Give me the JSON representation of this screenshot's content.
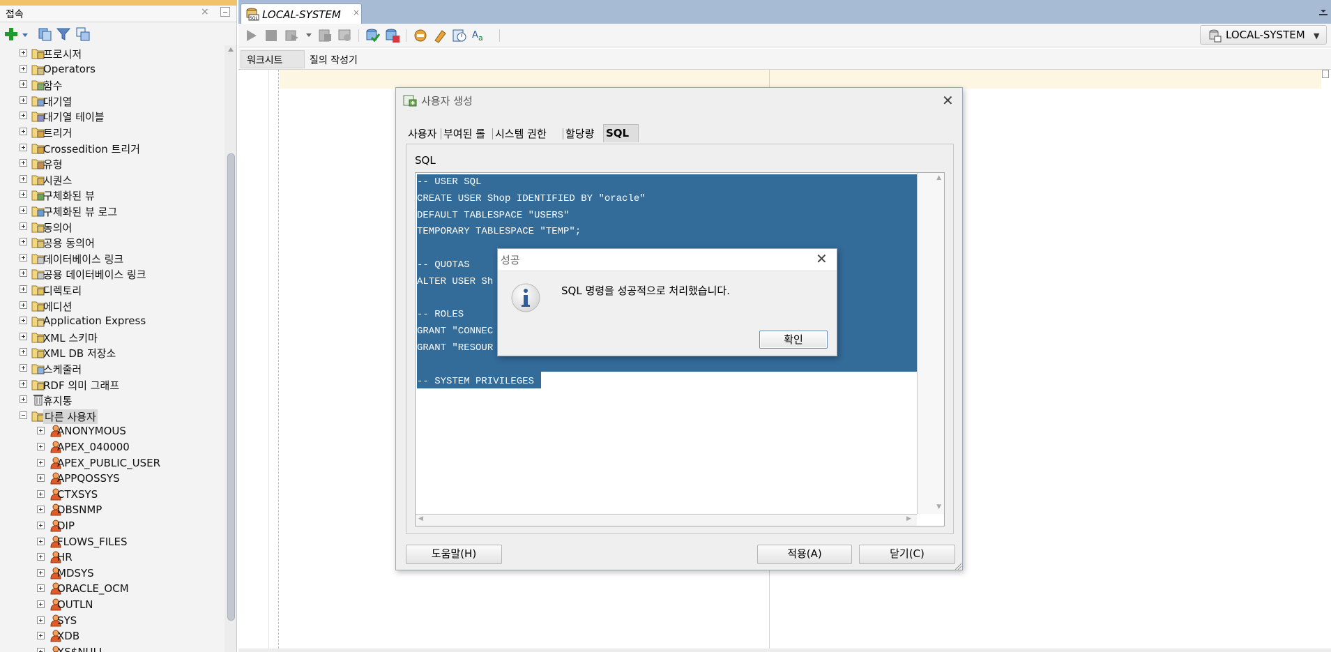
{
  "left_panel": {
    "title": "접속",
    "toolbar_icons": [
      "add-connection-icon",
      "dropdown-arrow-icon",
      "refresh-icon",
      "filter-icon",
      "schema-browser-icon"
    ],
    "tree": [
      {
        "label": "프로시저",
        "level": 1,
        "icon": "procedure-icon",
        "expanded": false
      },
      {
        "label": "Operators",
        "level": 1,
        "icon": "operator-icon",
        "expanded": false
      },
      {
        "label": "함수",
        "level": 1,
        "icon": "function-icon",
        "expanded": false
      },
      {
        "label": "대기열",
        "level": 1,
        "icon": "queue-icon",
        "expanded": false
      },
      {
        "label": "대기열 테이블",
        "level": 1,
        "icon": "queue-table-icon",
        "expanded": false
      },
      {
        "label": "트리거",
        "level": 1,
        "icon": "trigger-icon",
        "expanded": false
      },
      {
        "label": "Crossedition 트리거",
        "level": 1,
        "icon": "crossedition-trigger-icon",
        "expanded": false
      },
      {
        "label": "유형",
        "level": 1,
        "icon": "type-icon",
        "expanded": false
      },
      {
        "label": "시퀀스",
        "level": 1,
        "icon": "sequence-icon",
        "expanded": false
      },
      {
        "label": "구체화된 뷰",
        "level": 1,
        "icon": "materialized-view-icon",
        "expanded": false
      },
      {
        "label": "구체화된 뷰 로그",
        "level": 1,
        "icon": "materialized-view-log-icon",
        "expanded": false
      },
      {
        "label": "동의어",
        "level": 1,
        "icon": "synonym-icon",
        "expanded": false
      },
      {
        "label": "공용 동의어",
        "level": 1,
        "icon": "public-synonym-icon",
        "expanded": false
      },
      {
        "label": "데이터베이스 링크",
        "level": 1,
        "icon": "database-link-icon",
        "expanded": false
      },
      {
        "label": "공용 데이터베이스 링크",
        "level": 1,
        "icon": "public-database-link-icon",
        "expanded": false
      },
      {
        "label": "디렉토리",
        "level": 1,
        "icon": "directory-icon",
        "expanded": false
      },
      {
        "label": "에디션",
        "level": 1,
        "icon": "edition-icon",
        "expanded": false
      },
      {
        "label": "Application Express",
        "level": 1,
        "icon": "folder-icon",
        "expanded": false
      },
      {
        "label": "XML 스키마",
        "level": 1,
        "icon": "xml-schema-icon",
        "expanded": false
      },
      {
        "label": "XML DB 저장소",
        "level": 1,
        "icon": "xml-db-repository-icon",
        "expanded": false
      },
      {
        "label": "스케줄러",
        "level": 1,
        "icon": "scheduler-icon",
        "expanded": false
      },
      {
        "label": "RDF 의미 그래프",
        "level": 1,
        "icon": "rdf-graph-icon",
        "expanded": false
      },
      {
        "label": "휴지통",
        "level": 1,
        "icon": "recycle-bin-icon",
        "expanded": false
      },
      {
        "label": "다른 사용자",
        "level": 1,
        "icon": "other-users-icon",
        "expanded": true,
        "selected": true
      },
      {
        "label": "ANONYMOUS",
        "level": 2,
        "icon": "user-icon",
        "expanded": false
      },
      {
        "label": "APEX_040000",
        "level": 2,
        "icon": "user-icon",
        "expanded": false
      },
      {
        "label": "APEX_PUBLIC_USER",
        "level": 2,
        "icon": "user-icon",
        "expanded": false
      },
      {
        "label": "APPQOSSYS",
        "level": 2,
        "icon": "user-icon",
        "expanded": false
      },
      {
        "label": "CTXSYS",
        "level": 2,
        "icon": "user-icon",
        "expanded": false
      },
      {
        "label": "DBSNMP",
        "level": 2,
        "icon": "user-icon",
        "expanded": false
      },
      {
        "label": "DIP",
        "level": 2,
        "icon": "user-icon",
        "expanded": false
      },
      {
        "label": "FLOWS_FILES",
        "level": 2,
        "icon": "user-icon",
        "expanded": false
      },
      {
        "label": "HR",
        "level": 2,
        "icon": "user-icon",
        "expanded": false
      },
      {
        "label": "MDSYS",
        "level": 2,
        "icon": "user-icon",
        "expanded": false
      },
      {
        "label": "ORACLE_OCM",
        "level": 2,
        "icon": "user-icon",
        "expanded": false
      },
      {
        "label": "OUTLN",
        "level": 2,
        "icon": "user-icon",
        "expanded": false
      },
      {
        "label": "SYS",
        "level": 2,
        "icon": "user-icon",
        "expanded": false
      },
      {
        "label": "XDB",
        "level": 2,
        "icon": "user-icon",
        "expanded": false
      },
      {
        "label": "XS$NULL",
        "level": 2,
        "icon": "user-icon",
        "expanded": false
      }
    ]
  },
  "editor": {
    "doc_tab": {
      "label": "LOCAL-SYSTEM",
      "close": "×",
      "icon": "sql-worksheet-icon"
    },
    "toolbar_icons": [
      "run-statement-icon",
      "stop-icon",
      "run-script-icon",
      "dropdown-arrow-icon",
      "autotrace-icon",
      "explain-plan-icon",
      "commit-icon",
      "rollback-icon",
      "sql-tuning-icon",
      "clear-icon",
      "history-icon",
      "format-case-icon"
    ],
    "connection_select": {
      "value": "LOCAL-SYSTEM"
    },
    "sub_tabs": [
      {
        "label": "워크시트",
        "active": true
      },
      {
        "label": "질의 작성기",
        "active": false
      }
    ]
  },
  "create_user_dialog": {
    "title": "사용자 생성",
    "close": "✕",
    "tabs": [
      {
        "label": "사용자",
        "active": false
      },
      {
        "label": "부여된 롤",
        "active": false
      },
      {
        "label": "시스템 권한",
        "active": false
      },
      {
        "label": "할당량",
        "active": false
      },
      {
        "label": "SQL",
        "active": true
      }
    ],
    "sql_label": "SQL",
    "sql_text": "-- USER SQL\nCREATE USER Shop IDENTIFIED BY \"oracle\"\nDEFAULT TABLESPACE \"USERS\"\nTEMPORARY TABLESPACE \"TEMP\";\n\n-- QUOTAS\nALTER USER Sh\n\n-- ROLES\nGRANT \"CONNEC\nGRANT \"RESOUR\n\n-- SYSTEM PRIVILEGES",
    "buttons": {
      "help": "도움말(H)",
      "apply": "적용(A)",
      "close": "닫기(C)"
    },
    "colors": {
      "selection": "#336b99"
    }
  },
  "success_dialog": {
    "title": "성공",
    "close": "✕",
    "message": "SQL 명령을 성공적으로 처리했습니다.",
    "icon": "info-icon",
    "ok_label": "확인"
  }
}
